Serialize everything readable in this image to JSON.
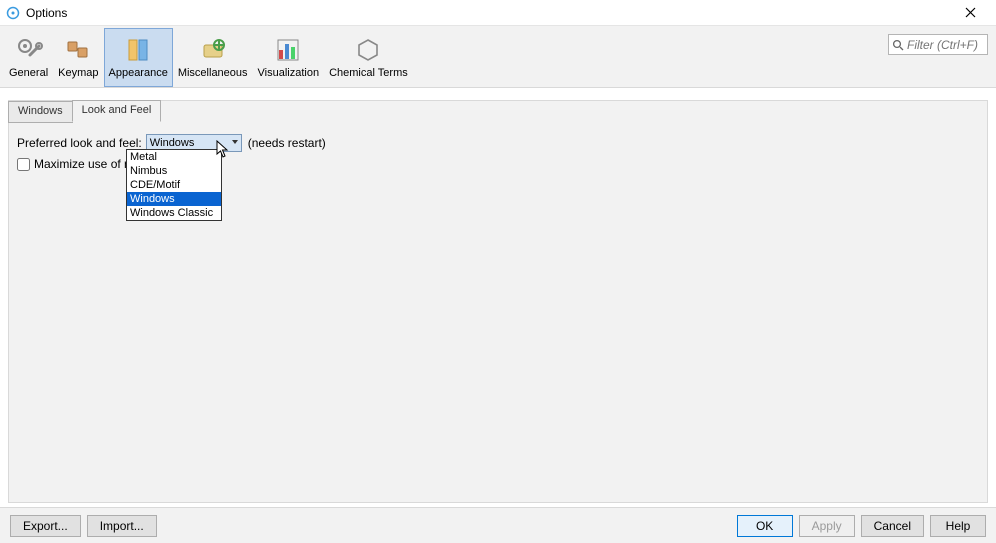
{
  "window": {
    "title": "Options"
  },
  "filter": {
    "placeholder": "Filter (Ctrl+F)"
  },
  "toolbar": {
    "items": [
      {
        "label": "General"
      },
      {
        "label": "Keymap"
      },
      {
        "label": "Appearance"
      },
      {
        "label": "Miscellaneous"
      },
      {
        "label": "Visualization"
      },
      {
        "label": "Chemical Terms"
      }
    ],
    "active_index": 2
  },
  "sub_tabs": {
    "items": [
      {
        "label": "Windows"
      },
      {
        "label": "Look and Feel"
      }
    ],
    "active_index": 1
  },
  "form": {
    "laf_label": "Preferred look and feel:",
    "laf_selected": "Windows",
    "laf_hint": "(needs restart)",
    "maximize_label": "Maximize use of nat",
    "laf_options": [
      {
        "label": "Metal"
      },
      {
        "label": "Nimbus"
      },
      {
        "label": "CDE/Motif"
      },
      {
        "label": "Windows"
      },
      {
        "label": "Windows Classic"
      }
    ],
    "highlighted_index": 3
  },
  "buttons": {
    "export": "Export...",
    "import": "Import...",
    "ok": "OK",
    "apply": "Apply",
    "cancel": "Cancel",
    "help": "Help"
  }
}
